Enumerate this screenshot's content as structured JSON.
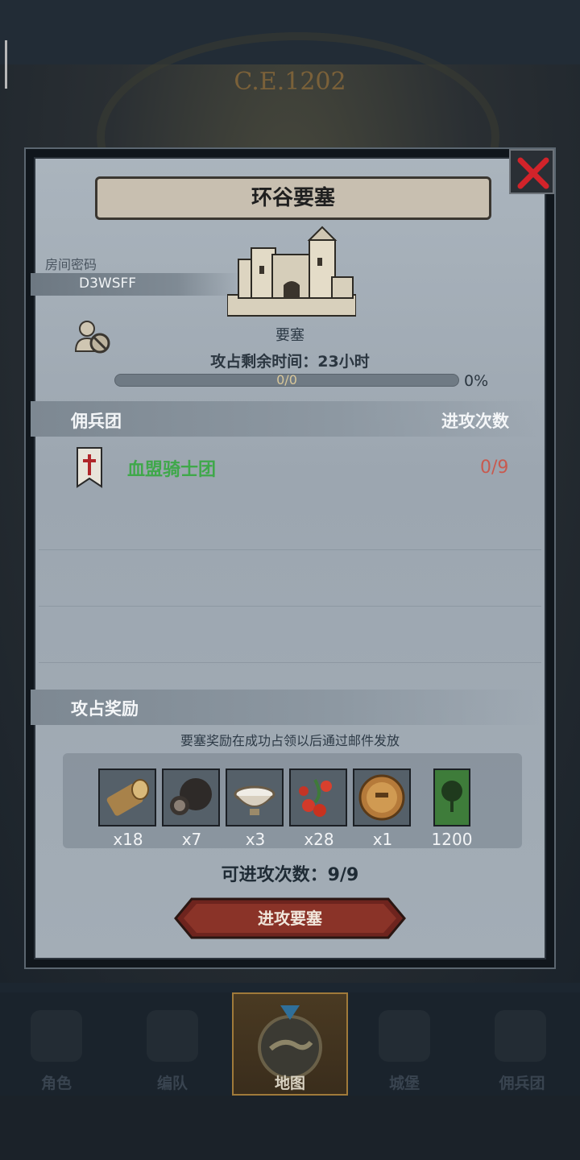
{
  "background": {
    "year_label": "C.E.1202"
  },
  "modal": {
    "title": "环谷要塞",
    "room": {
      "label": "房间密码",
      "code": "D3WSFF"
    },
    "fortress_type": "要塞",
    "remaining_time": "攻占剩余时间：23小时",
    "progress": {
      "text": "0/0",
      "percent": "0%",
      "fraction": 0
    },
    "mercenary_section": {
      "title": "佣兵团",
      "right_label": "进攻次数"
    },
    "mercenaries": [
      {
        "name": "血盟骑士团",
        "attacks": "0/9",
        "icon": "crusader-banner-icon"
      }
    ],
    "reward_section": {
      "title": "攻占奖励",
      "note": "要塞奖励在成功占领以后通过邮件发放"
    },
    "rewards": [
      {
        "icon": "wood-log-icon",
        "qty": "x18"
      },
      {
        "icon": "truffle-icon",
        "qty": "x7"
      },
      {
        "icon": "milk-bowl-icon",
        "qty": "x3"
      },
      {
        "icon": "berries-icon",
        "qty": "x28"
      },
      {
        "icon": "knight-medal-icon",
        "qty": "x1"
      },
      {
        "icon": "tree-banner-icon",
        "qty": "1200"
      }
    ],
    "attempts": "可进攻次数：9/9",
    "attack_button": "进攻要塞"
  },
  "nav": [
    {
      "label": "角色",
      "icon": "character-icon",
      "active": false
    },
    {
      "label": "编队",
      "icon": "formation-icon",
      "active": false
    },
    {
      "label": "地图",
      "icon": "map-icon",
      "active": true
    },
    {
      "label": "城堡",
      "icon": "castle-icon",
      "active": false
    },
    {
      "label": "佣兵团",
      "icon": "mercenary-icon",
      "active": false
    }
  ],
  "colors": {
    "accent_green": "#3fa84a",
    "accent_red": "#c85a4f",
    "button_red": "#7a2a22"
  }
}
